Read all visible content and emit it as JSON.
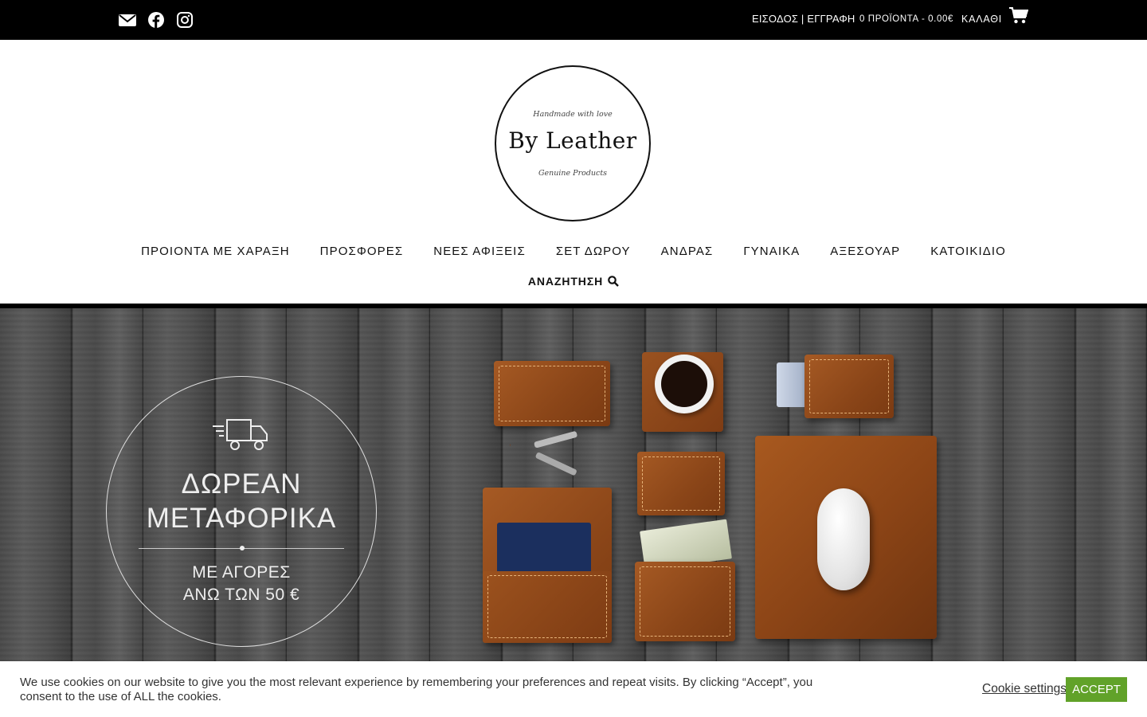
{
  "topbar": {
    "social": [
      {
        "icon": "envelope-icon"
      },
      {
        "icon": "facebook-icon"
      },
      {
        "icon": "instagram-icon"
      }
    ],
    "login": "ΕΙΣΟΔΟΣ",
    "separator": " | ",
    "register": "ΕΓΓΡΑΦΗ",
    "cart_summary": "0 ΠΡΟΪΟΝΤΑ - 0.00€",
    "cart_label": "ΚΑΛΑΘΙ",
    "cart_icon": "shopping-cart-icon"
  },
  "logo": {
    "tagline_top": "Handmade with love",
    "brand": "By Leather",
    "tagline_bottom": "Genuine Products"
  },
  "nav": {
    "items": [
      "ΠΡΟΙΟΝΤΑ ΜΕ ΧΑΡΑΞΗ",
      "ΠΡΟΣΦΟΡΕΣ",
      "ΝΕΕΣ ΑΦΙΞΕΙΣ",
      "ΣΕΤ ΔΩΡΟΥ",
      "ΑΝΔΡΑΣ",
      "ΓΥΝΑΙΚΑ",
      "ΑΞΕΣΟΥΑΡ",
      "ΚΑΤΟΙΚΙΔΙΟ"
    ],
    "search_label": "ΑΝΑΖΗΤΗΣΗ",
    "search_icon": "search-icon"
  },
  "hero": {
    "promo_line1": "ΔΩΡΕΑΝ",
    "promo_line2": "ΜΕΤΑΦΟΡΙΚΑ",
    "promo_sub1": "ΜΕ ΑΓΟΡΕΣ",
    "promo_sub2": "ΑΝΩ ΤΩΝ 50 €",
    "promo_icon": "delivery-truck-icon"
  },
  "cookie": {
    "message": "We use cookies on our website to give you the most relevant experience by remembering your preferences and repeat visits. By clicking “Accept”, you consent to the use of ALL the cookies.",
    "settings_label": "Cookie settings",
    "accept_label": "ACCEPT",
    "accept_color": "#61a229"
  }
}
